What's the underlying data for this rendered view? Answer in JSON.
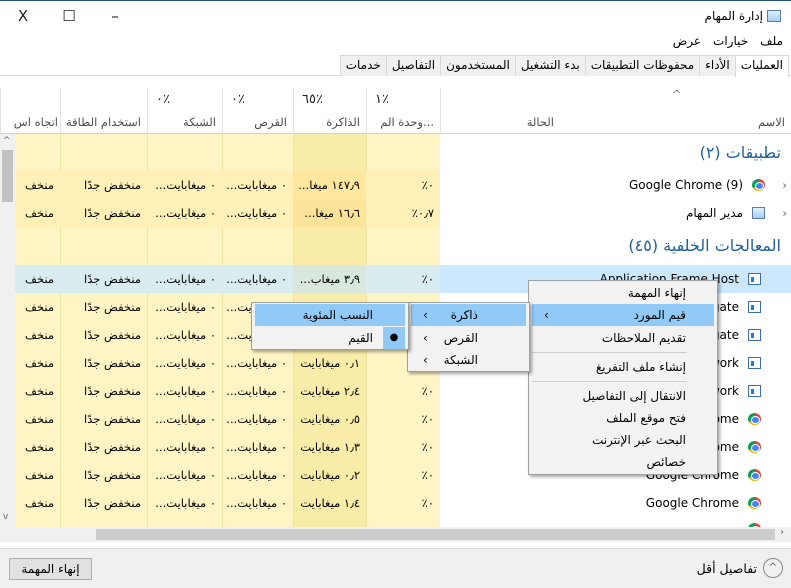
{
  "window": {
    "title": "إدارة المهام",
    "controls": {
      "close": "X",
      "maximize": "☐",
      "minimize": "–"
    }
  },
  "menubar": [
    "ملف",
    "خيارات",
    "عرض"
  ],
  "tabs": [
    "العمليات",
    "الأداء",
    "محفوظات التطبيقات",
    "بدء التشغيل",
    "المستخدمون",
    "التفاصيل",
    "خدمات"
  ],
  "active_tab": "العمليات",
  "columns": {
    "name": {
      "label": "الاسم"
    },
    "status": {
      "label": "الحالة"
    },
    "cpu": {
      "label": "وحدة الم...",
      "pct": "١٪"
    },
    "memory": {
      "label": "الذاكرة",
      "pct": "٦٥٪"
    },
    "disk": {
      "label": "القرص",
      "pct": "٠٪"
    },
    "network": {
      "label": "الشبكة",
      "pct": "٠٪"
    },
    "power": {
      "label": "استخدام الطاقة"
    },
    "trend": {
      "label": "اتجاه اس"
    }
  },
  "groups": {
    "apps": "تطبيقات (٢)",
    "background": "المعالجات الخلفية (٤٥)"
  },
  "apps": [
    {
      "name": "Google Chrome (9)",
      "icon": "chrome-icon",
      "cpu": "٠٪",
      "memory": "١٤٧٫٩ ميغا...",
      "disk": "٠ ميغابايت...",
      "network": "٠ ميغابايت...",
      "power": "منخفض جدًا",
      "trend": "منخف"
    },
    {
      "name": "مدير المهام",
      "icon": "task-manager-icon",
      "cpu": "٠٫٧٪",
      "memory": "١٦٫٦ ميغا...",
      "disk": "٠ ميغابايت...",
      "network": "٠ ميغابايت...",
      "power": "منخفض جدًا",
      "trend": "منخف"
    }
  ],
  "background": [
    {
      "name": "Application Frame Host",
      "icon": "app-window-icon",
      "cpu": "٠٪",
      "memory": "٣٫٩ ميغاب...",
      "disk": "٠ ميغابايت...",
      "network": "٠ ميغابايت...",
      "power": "منخفض جدًا",
      "trend": "منخف",
      "selected": true
    },
    {
      "name": "gate",
      "icon": "app-window-icon",
      "cpu": "",
      "memory": "",
      "disk": "٠ ميغابايت...",
      "network": "٠ ميغابايت...",
      "power": "منخفض جدًا",
      "trend": "منخف"
    },
    {
      "name": "gate",
      "icon": "app-window-icon",
      "cpu": "",
      "memory": "",
      "disk": "٠ ميغابايت...",
      "network": "٠ ميغابايت...",
      "power": "منخفض جدًا",
      "trend": "منخف"
    },
    {
      "name": "work",
      "icon": "app-window-icon",
      "cpu": "٠٪",
      "memory": "٠٫١ ميغابايت",
      "disk": "٠ ميغابايت...",
      "network": "٠ ميغابايت...",
      "power": "منخفض جدًا",
      "trend": "منخف"
    },
    {
      "name": "work",
      "icon": "app-window-icon",
      "cpu": "٠٪",
      "memory": "٢٫٤ ميغابايت",
      "disk": "٠ ميغابايت...",
      "network": "٠ ميغابايت...",
      "power": "منخفض جدًا",
      "trend": "منخف"
    },
    {
      "name": "ome",
      "icon": "chrome-icon",
      "cpu": "٠٪",
      "memory": "٠٫٥ ميغابايت",
      "disk": "٠ ميغابايت...",
      "network": "٠ ميغابايت...",
      "power": "منخفض جدًا",
      "trend": "منخف"
    },
    {
      "name": "ome",
      "icon": "chrome-icon",
      "cpu": "٠٪",
      "memory": "١٫٣ ميغابايت",
      "disk": "٠ ميغابايت...",
      "network": "٠ ميغابايت...",
      "power": "منخفض جدًا",
      "trend": "منخف"
    },
    {
      "name": "Google Chrome",
      "icon": "chrome-icon",
      "cpu": "٠٪",
      "memory": "٠٫٢ ميغابايت",
      "disk": "٠ ميغابايت...",
      "network": "٠ ميغابايت...",
      "power": "منخفض جدًا",
      "trend": "منخف"
    },
    {
      "name": "Google Chrome",
      "icon": "chrome-icon",
      "cpu": "٠٪",
      "memory": "١٫٤ ميغابايت",
      "disk": "٠ ميغابايت...",
      "network": "٠ ميغابايت...",
      "power": "منخفض جدًا",
      "trend": "منخف"
    }
  ],
  "context_menu": {
    "items": [
      "إنهاء المهمة",
      "قيم المورد",
      "تقديم الملاحظات",
      "إنشاء ملف التفريغ",
      "الانتقال إلى التفاصيل",
      "فتح موقع الملف",
      "البحث عبر الإنترنت",
      "خصائص"
    ],
    "highlighted": "قيم المورد"
  },
  "resource_submenu": {
    "items": [
      "ذاكرة",
      "القرص",
      "الشبكة"
    ],
    "highlighted": "ذاكرة"
  },
  "memory_submenu": {
    "items": [
      "النسب المئوية",
      "القيم"
    ],
    "highlighted": "النسب المئوية",
    "checked": "القيم"
  },
  "footer": {
    "end_task": "إنهاء المهمة",
    "fewer_details": "تفاصيل أقل"
  },
  "colors": {
    "selected_row": "#cce8ff",
    "heat_light": "#fff4c4",
    "heat_mid": "#f9eca8",
    "menu_highlight": "#91c9f7",
    "group_header": "#1f5f9f"
  }
}
